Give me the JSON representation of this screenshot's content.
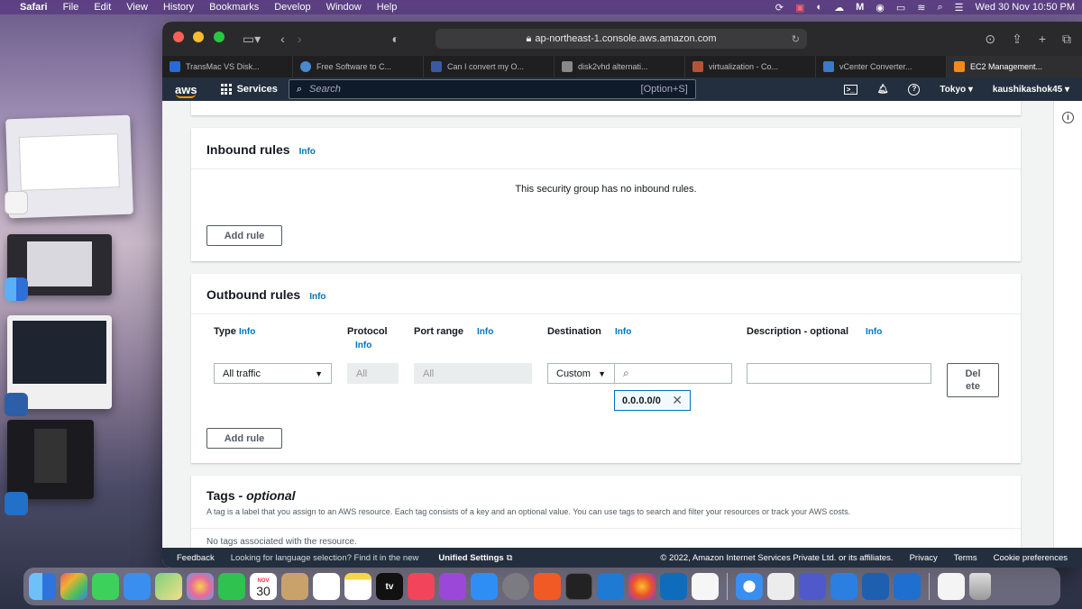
{
  "menubar": {
    "app": "Safari",
    "items": [
      "File",
      "Edit",
      "View",
      "History",
      "Bookmarks",
      "Develop",
      "Window",
      "Help"
    ],
    "datetime": "Wed 30 Nov  10:50 PM"
  },
  "browser": {
    "url": "ap-northeast-1.console.aws.amazon.com",
    "tabs": [
      {
        "label": "TransMac VS Disk...",
        "color": "#2a6ad8"
      },
      {
        "label": "Free Software to C...",
        "color": "#4a8ad0"
      },
      {
        "label": "Can I convert my O...",
        "color": "#3a5aa0"
      },
      {
        "label": "disk2vhd alternati...",
        "color": "#888888"
      },
      {
        "label": "virtualization - Co...",
        "color": "#b5533a"
      },
      {
        "label": "vCenter Converter...",
        "color": "#3a7ac8"
      },
      {
        "label": "EC2 Management...",
        "color": "#f08a1c"
      }
    ]
  },
  "awsnav": {
    "logo": "aws",
    "services": "Services",
    "search_placeholder": "Search",
    "search_shortcut": "[Option+S]",
    "region": "Tokyo ▾",
    "user": "kaushikashok45 ▾"
  },
  "inbound": {
    "title": "Inbound rules",
    "info": "Info",
    "empty_text": "This security group has no inbound rules.",
    "add_rule": "Add rule"
  },
  "outbound": {
    "title": "Outbound rules",
    "info": "Info",
    "columns": {
      "type": "Type",
      "type_info": "Info",
      "protocol": "Protocol",
      "protocol_info": "Info",
      "port_range": "Port range",
      "port_info": "Info",
      "destination": "Destination",
      "destination_info": "Info",
      "description": "Description - optional",
      "description_info": "Info"
    },
    "row": {
      "type_value": "All traffic",
      "protocol_value": "All",
      "port_value": "All",
      "destination_mode": "Custom",
      "destination_token": "0.0.0.0/0",
      "delete_line1": "Del",
      "delete_line2": "ete"
    },
    "add_rule": "Add rule"
  },
  "tags": {
    "title_prefix": "Tags - ",
    "title_italic": "optional",
    "description": "A tag is a label that you assign to an AWS resource. Each tag consists of a key and an optional value. You can use tags to search and filter your resources or track your AWS costs.",
    "empty_text": "No tags associated with the resource."
  },
  "footer": {
    "feedback": "Feedback",
    "language_prompt": "Looking for language selection? Find it in the new",
    "unified_settings": "Unified Settings",
    "copyright": "© 2022, Amazon Internet Services Private Ltd. or its affiliates.",
    "privacy": "Privacy",
    "terms": "Terms",
    "cookie": "Cookie preferences"
  },
  "dock": {
    "calendar_month": "NOV",
    "calendar_day": "30",
    "tv_label": "tv"
  }
}
